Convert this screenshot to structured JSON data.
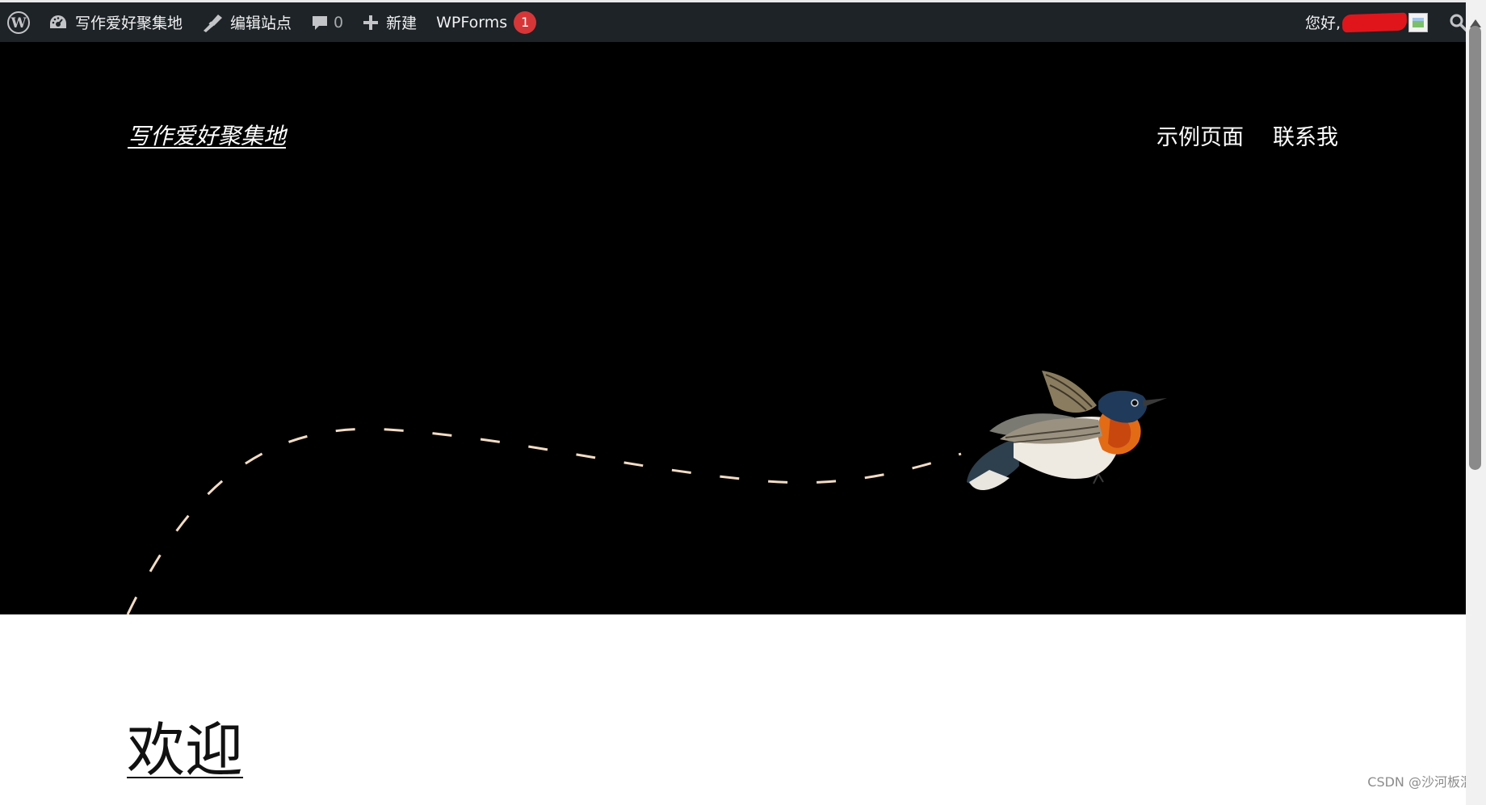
{
  "admin_bar": {
    "site_name": "写作爱好聚集地",
    "edit_site": "编辑站点",
    "comments_count": "0",
    "new_label": "新建",
    "wpforms_label": "WPForms",
    "wpforms_badge": "1",
    "greeting": "您好,",
    "icons": [
      "wordpress-logo-icon",
      "dashboard-icon",
      "brush-icon",
      "comment-icon",
      "plus-icon",
      "search-icon"
    ]
  },
  "header": {
    "site_title": "写作爱好聚集地",
    "nav": [
      {
        "label": "示例页面"
      },
      {
        "label": "联系我"
      }
    ]
  },
  "hero": {
    "background": "#000000",
    "path_color": "#f3dcc4",
    "image": "flying-bird-illustration"
  },
  "main": {
    "heading": "欢迎"
  },
  "watermark": "CSDN @沙河板混",
  "colors": {
    "admin_bar": "#1d2327",
    "badge": "#d63638",
    "text_light": "#f0f0f1"
  }
}
